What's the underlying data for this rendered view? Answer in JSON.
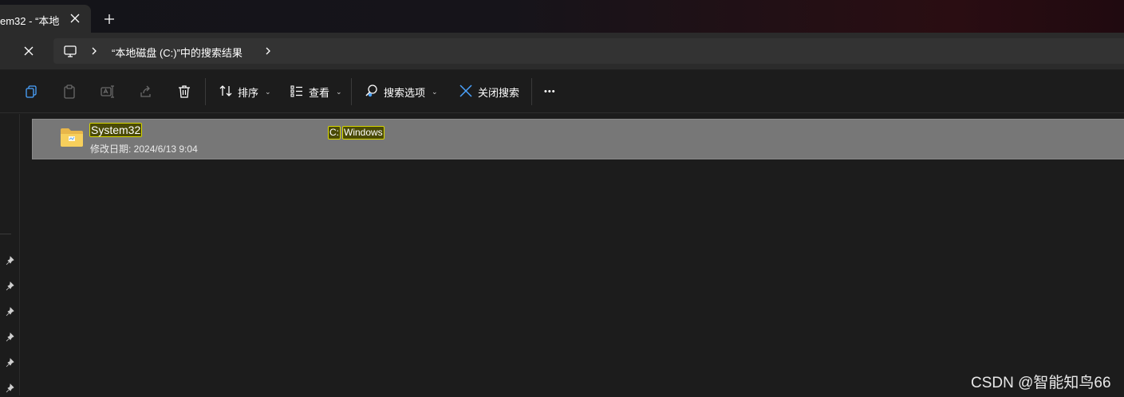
{
  "titlebar": {
    "tab_title": "em32 - “本地",
    "close_icon": "close-icon",
    "new_tab_icon": "plus-icon"
  },
  "addressbar": {
    "close_icon": "close-icon",
    "pc_icon": "monitor-icon",
    "crumb": "“本地磁盘 (C:)”中的搜索结果"
  },
  "toolbar": {
    "sort_label": "排序",
    "view_label": "查看",
    "search_options_label": "搜索选项",
    "close_search_label": "关闭搜索",
    "more_label": "•••",
    "accent": "#4aa3ff"
  },
  "results": [
    {
      "name": "System32",
      "modified": "修改日期: 2024/6/13 9:04",
      "path_drive": "C:",
      "path_folder": "Windows"
    }
  ],
  "highlight_color": "#d6d600",
  "selection_color": "#777777",
  "watermark": "CSDN @智能知鸟66"
}
